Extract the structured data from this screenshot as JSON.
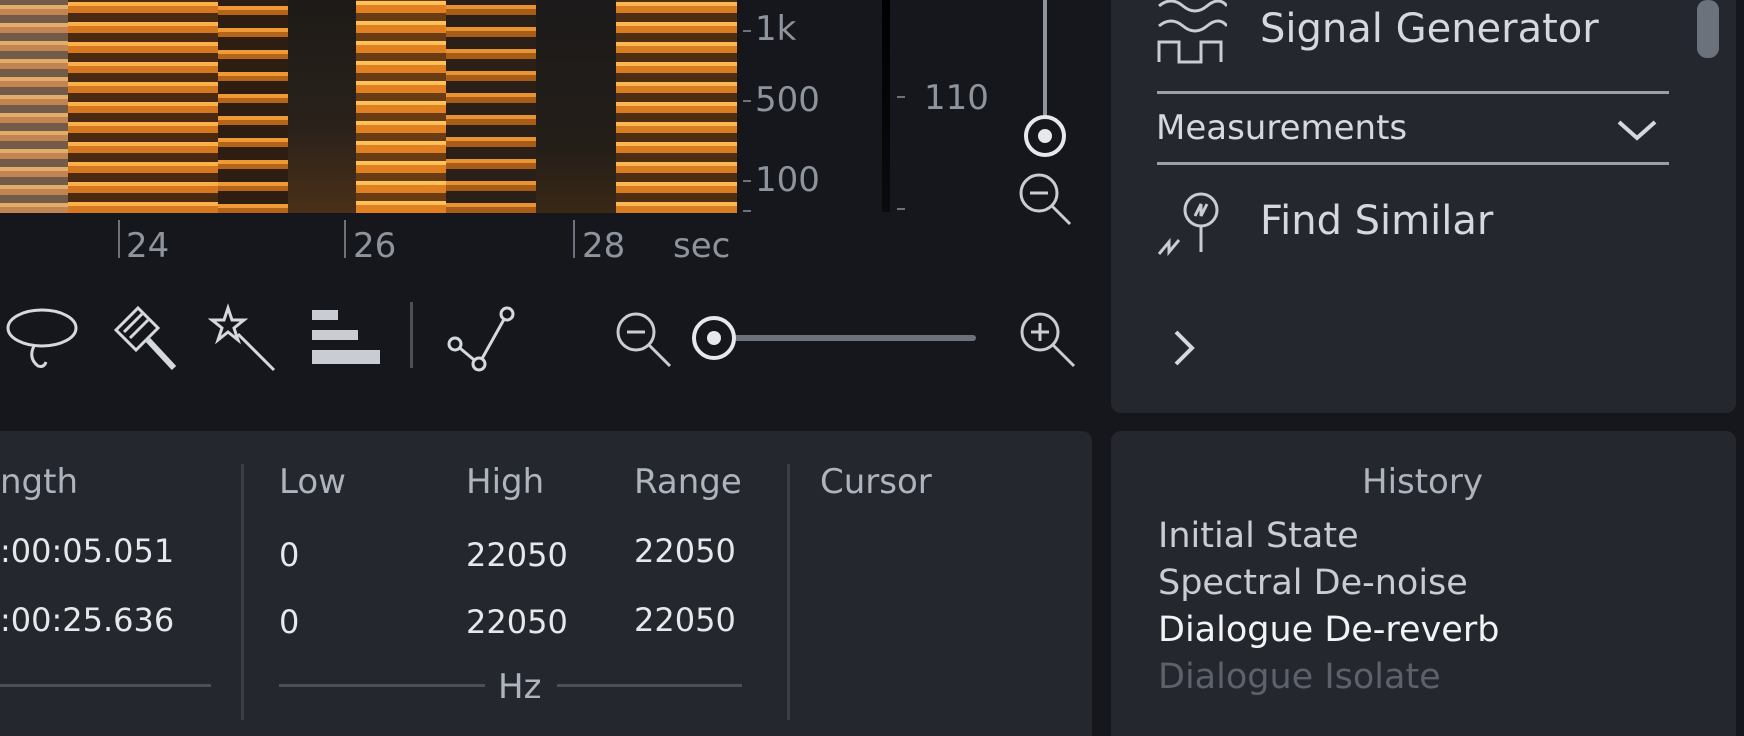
{
  "spectrogram": {
    "freq_labels": [
      "1k",
      "500",
      "100"
    ],
    "time_labels": [
      "24",
      "26",
      "28",
      "sec"
    ],
    "db_label": "110"
  },
  "modules": {
    "signal_generator": "Signal Generator",
    "measurements": "Measurements",
    "find_similar": "Find Similar"
  },
  "info": {
    "headers": [
      "ngth",
      "Low",
      "High",
      "Range",
      "Cursor"
    ],
    "length": [
      ":00:05.051",
      ":00:25.636"
    ],
    "rows": [
      {
        "low": "0",
        "high": "22050",
        "range": "22050"
      },
      {
        "low": "0",
        "high": "22050",
        "range": "22050"
      }
    ],
    "unit": "Hz"
  },
  "history": {
    "title": "History",
    "items": [
      "Initial State",
      "Spectral De-noise",
      "Dialogue De-reverb",
      "Dialogue Isolate"
    ]
  },
  "colors": {
    "accent_orange": "#e8902a",
    "panel_bg": "#24272e",
    "app_bg": "#15171c"
  }
}
